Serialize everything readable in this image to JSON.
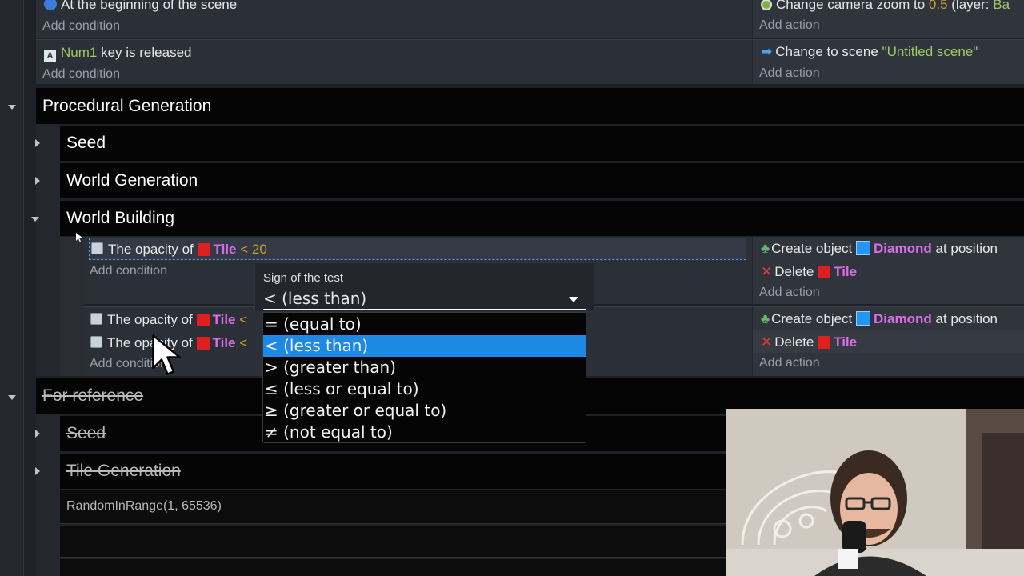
{
  "events": {
    "event1": {
      "condition_text": "At the beginning of the scene",
      "add_condition": "Add condition",
      "action_text_prefix": "Change camera zoom to",
      "action_value": "0.5",
      "action_suffix": "(layer:",
      "action_layer_partial": "Ba",
      "add_action": "Add action"
    },
    "event2": {
      "key_name": "Num1",
      "condition_text": "key is released",
      "add_condition": "Add condition",
      "action_text_prefix": "Change to scene",
      "action_scene": "\"Untitled scene\"",
      "add_action": "Add action"
    }
  },
  "groups": {
    "procedural": "Procedural Generation",
    "seed": "Seed",
    "world_generation": "World Generation",
    "world_building": "World Building",
    "for_reference": "For reference",
    "seed2": "Seed",
    "tile_generation": "Tile Generation",
    "random_expr": "RandomInRange(1, 65536)"
  },
  "world_building_events": {
    "e1": {
      "cond_prefix": "The opacity of",
      "cond_object": "Tile",
      "cond_op": "<",
      "cond_value": "20",
      "add_condition": "Add condition",
      "act1_prefix": "Create object",
      "act1_object": "Diamond",
      "act1_suffix": "at position",
      "act2_prefix": "Delete",
      "act2_object": "Tile",
      "add_action": "Add action"
    },
    "e2": {
      "cond1_prefix": "The opacity of",
      "cond1_object": "Tile",
      "cond1_op": "<",
      "cond2_prefix": "The opacity of",
      "cond2_object": "Tile",
      "cond2_op": "<",
      "add_condition": "Add condition",
      "act1_prefix": "Create object",
      "act1_object": "Diamond",
      "act1_suffix": "at position",
      "act2_prefix": "Delete",
      "act2_object": "Tile",
      "add_action": "Add action"
    }
  },
  "popup": {
    "label": "Sign of the test",
    "selected_value": "< (less than)",
    "options": [
      "= (equal to)",
      "< (less than)",
      "> (greater than)",
      "≤ (less or equal to)",
      "≥ (greater or equal to)",
      "≠ (not equal to)"
    ],
    "selected_index": 1
  },
  "colors": {
    "accent": "#1e88e5",
    "green_text": "#9ccc65",
    "object_pink": "#d86ee8",
    "tile_red": "#e02020",
    "diamond_blue": "#2196f3"
  }
}
